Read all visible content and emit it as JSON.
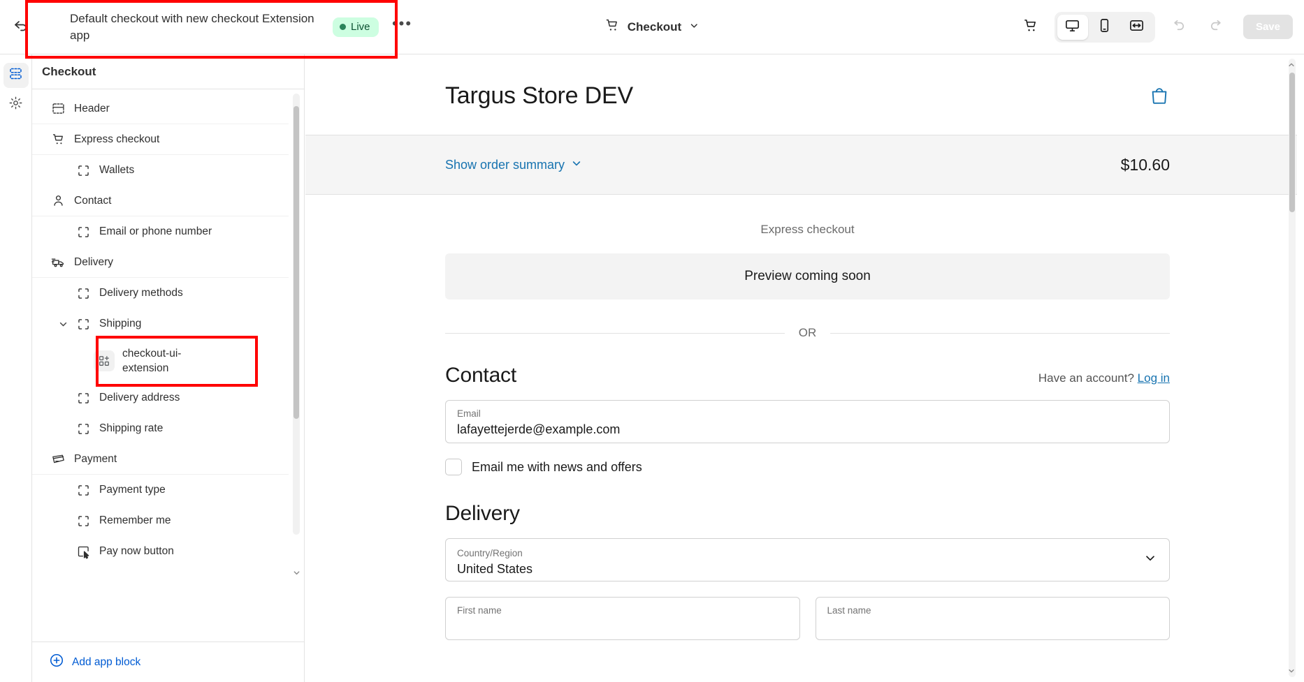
{
  "topbar": {
    "back_icon": "back-arrow-icon",
    "title": "Default checkout with new checkout Extension app",
    "status_badge": "Live",
    "more_label": "•••",
    "center_label": "Checkout",
    "cart_icon": "cart-icon",
    "devices": [
      {
        "name": "desktop",
        "icon": "desktop-icon",
        "active": true
      },
      {
        "name": "mobile",
        "icon": "mobile-icon",
        "active": false
      },
      {
        "name": "full-width",
        "icon": "fullwidth-icon",
        "active": false
      }
    ],
    "undo_icon": "undo-icon",
    "redo_icon": "redo-icon",
    "save_label": "Save",
    "accent_color": "#005bd3",
    "live_bg": "#cdfee1",
    "live_fg": "#0c5132"
  },
  "rail": {
    "items": [
      {
        "name": "sections",
        "icon": "sections-icon",
        "active": true
      },
      {
        "name": "settings",
        "icon": "gear-icon",
        "active": false
      }
    ]
  },
  "panel": {
    "title": "Checkout",
    "tree": [
      {
        "label": "Header",
        "icon": "header-icon",
        "level": 0,
        "kind": "section"
      },
      {
        "label": "Express checkout",
        "icon": "cart-icon",
        "level": 0,
        "kind": "section"
      },
      {
        "label": "Wallets",
        "icon": "block-icon",
        "level": 1,
        "kind": "block"
      },
      {
        "label": "Contact",
        "icon": "person-icon",
        "level": 0,
        "kind": "section"
      },
      {
        "label": "Email or phone number",
        "icon": "block-icon",
        "level": 1,
        "kind": "block"
      },
      {
        "label": "Delivery",
        "icon": "truck-icon",
        "level": 0,
        "kind": "section"
      },
      {
        "label": "Delivery methods",
        "icon": "block-icon",
        "level": 1,
        "kind": "block"
      },
      {
        "label": "Shipping",
        "icon": "block-icon",
        "level": 1,
        "kind": "block",
        "caret": "chevron-down-icon"
      },
      {
        "label": "checkout-ui-extension",
        "icon": "app-block-icon",
        "level": 2,
        "kind": "app"
      },
      {
        "label": "Delivery address",
        "icon": "block-icon",
        "level": 1,
        "kind": "block"
      },
      {
        "label": "Shipping rate",
        "icon": "block-icon",
        "level": 1,
        "kind": "block"
      },
      {
        "label": "Payment",
        "icon": "payment-icon",
        "level": 0,
        "kind": "section"
      },
      {
        "label": "Payment type",
        "icon": "block-icon",
        "level": 1,
        "kind": "block"
      },
      {
        "label": "Remember me",
        "icon": "block-icon",
        "level": 1,
        "kind": "block"
      },
      {
        "label": "Pay now button",
        "icon": "paynow-icon",
        "level": 1,
        "kind": "block"
      }
    ],
    "add_app_block": "Add app block",
    "add_icon": "plus-circle-icon"
  },
  "preview": {
    "shop_name": "Targus Store DEV",
    "bag_icon": "shopping-bag-icon",
    "bag_color": "#1773b0",
    "order_summary_label": "Show order summary",
    "order_summary_caret": "chevron-down-icon",
    "order_total": "$10.60",
    "express_label": "Express checkout",
    "express_placeholder": "Preview coming soon",
    "or_divider": "OR",
    "contact": {
      "title": "Contact",
      "account_prompt": "Have an account?",
      "login_link": "Log in",
      "email_label": "Email",
      "email_value": "lafayettejerde@example.com",
      "newsletter_label": "Email me with news and offers"
    },
    "delivery": {
      "title": "Delivery",
      "country_label": "Country/Region",
      "country_value": "United States",
      "first_name_placeholder": "First name",
      "last_name_placeholder": "Last name"
    }
  }
}
